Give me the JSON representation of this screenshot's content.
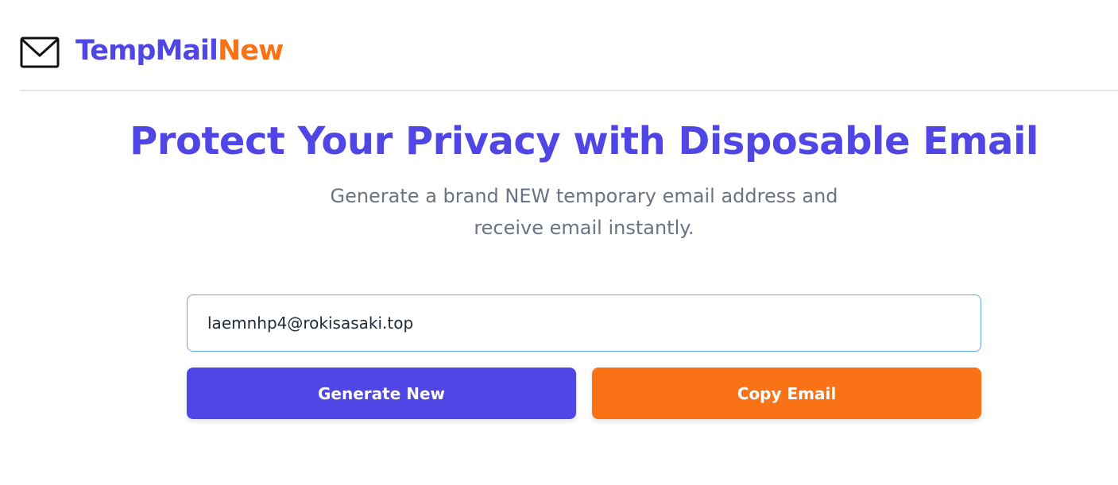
{
  "header": {
    "brand_part1": "TempMail",
    "brand_part2": "New",
    "logo_icon": "envelope-icon"
  },
  "hero": {
    "title": "Protect Your Privacy with Disposable Email",
    "subtitle_line1": "Generate a brand NEW temporary email address and",
    "subtitle_line2": "receive email instantly."
  },
  "email": {
    "value": "laemnhp4@rokisasaki.top"
  },
  "actions": {
    "generate_label": "Generate New",
    "copy_label": "Copy Email"
  },
  "colors": {
    "primary": "#4f46e5",
    "accent": "#f97316",
    "subtitle": "#6b7280",
    "input_border": "#60a5fa"
  }
}
